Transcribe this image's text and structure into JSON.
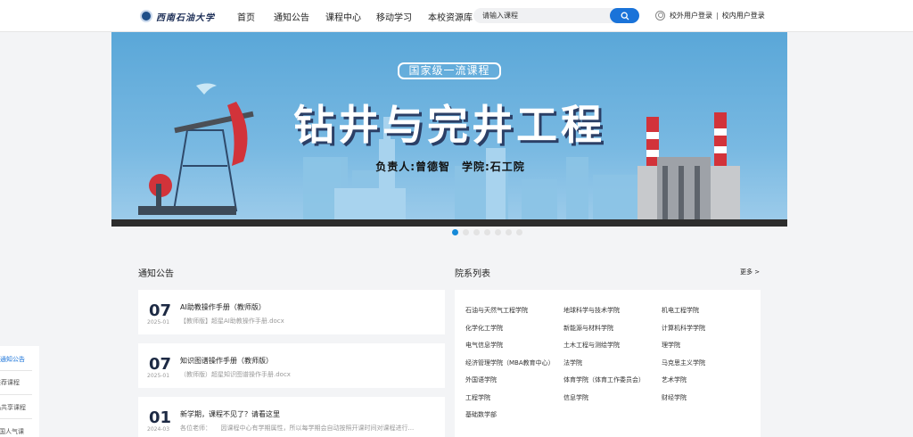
{
  "header": {
    "logo_text": "西南石油大学",
    "nav": [
      "首页",
      "通知公告",
      "课程中心",
      "移动学习",
      "本校资源库"
    ],
    "search_placeholder": "请输入课程",
    "login_external": "校外用户登录",
    "login_separator": "|",
    "login_internal": "校内用户登录"
  },
  "banner": {
    "badge": "国家级一流课程",
    "title": "钻井与完井工程",
    "subtitle": "负责人:曾德智　学院:石工院",
    "slide_count": 7,
    "active_slide": 0
  },
  "notices": {
    "title": "通知公告",
    "items": [
      {
        "day": "07",
        "ym": "2025-01",
        "title": "AI助教操作手册（教师版）",
        "desc": "【教师版】超星AI助教操作手册.docx"
      },
      {
        "day": "07",
        "ym": "2025-01",
        "title": "知识图谱操作手册（教师版）",
        "desc": "（教师版）超星知识图谱操作手册.docx"
      },
      {
        "day": "01",
        "ym": "2024-03",
        "title": "新学期，课程不见了？请看这里",
        "desc": "各位老师：　　因课程中心有学期属性，所以每学期会自动按照开课时间对课程进行..."
      }
    ]
  },
  "departments": {
    "title": "院系列表",
    "more": "更多 >",
    "items": [
      "石油与天然气工程学院",
      "地球科学与技术学院",
      "机电工程学院",
      "化学化工学院",
      "新能源与材料学院",
      "计算机科学学院",
      "电气信息学院",
      "土木工程与测绘学院",
      "理学院",
      "经济管理学院（MBA教育中心）",
      "法学院",
      "马克思主义学院",
      "外国语学院",
      "体育学院（体育工作委员会）",
      "艺术学院",
      "工程学院",
      "信息学院",
      "财经学院",
      "基础数学部"
    ]
  },
  "side_tabs": [
    "通知公告",
    "推荐课程",
    "精品共享课程",
    "全国人气课"
  ],
  "colors": {
    "accent": "#1a73d9",
    "dot_active": "#1589d8"
  }
}
